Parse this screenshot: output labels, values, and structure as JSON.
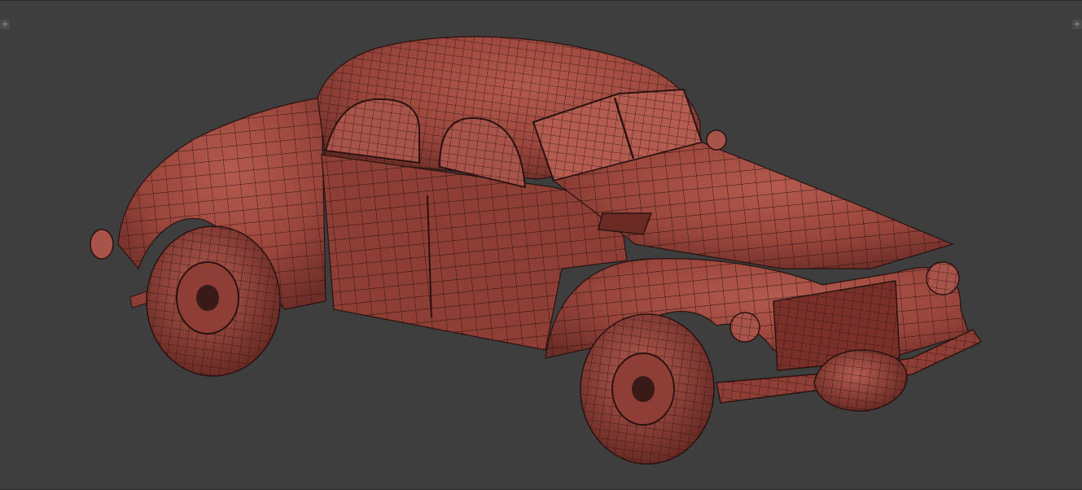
{
  "viewport": {
    "background_color": "#3e3e3e",
    "mesh_fill_color": "#9c4a40",
    "mesh_shade_color": "#7e3630",
    "mesh_highlight_color": "#c26a5e",
    "wire_color": "#2a1210",
    "expand_left_icon": "plus-icon",
    "expand_right_icon": "plus-icon",
    "expand_left_glyph": "+",
    "expand_right_glyph": "+"
  }
}
